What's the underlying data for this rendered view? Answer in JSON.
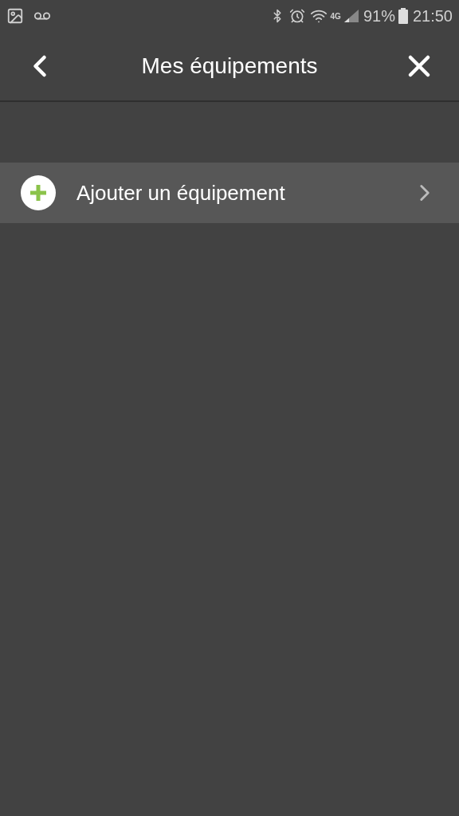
{
  "status_bar": {
    "network": "4G",
    "battery": "91%",
    "time": "21:50"
  },
  "header": {
    "title": "Mes équipements"
  },
  "items": [
    {
      "label": "Ajouter un équipement"
    }
  ]
}
